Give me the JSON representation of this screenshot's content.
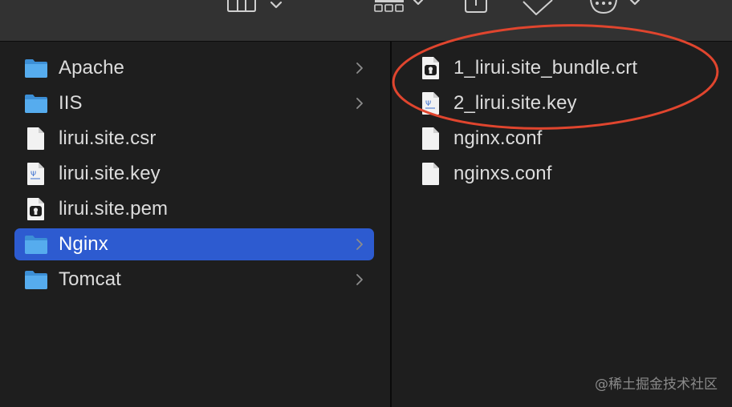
{
  "colors": {
    "toolbar_bg": "#323232",
    "window_bg": "#1e1e1e",
    "selection": "#2d5bd0",
    "folder_blue": "#4aa3e8",
    "text": "#dcdcdc",
    "annotation_red": "#e0452e"
  },
  "toolbar": {
    "icons": [
      "column-view-icon",
      "view-options-chevron-icon",
      "group-icon",
      "share-icon",
      "tag-icon",
      "more-icon"
    ]
  },
  "left_column": {
    "items": [
      {
        "label": "Apache",
        "type": "folder",
        "has_children": true,
        "selected": false
      },
      {
        "label": "IIS",
        "type": "folder",
        "has_children": true,
        "selected": false
      },
      {
        "label": "lirui.site.csr",
        "type": "blank-file",
        "has_children": false,
        "selected": false
      },
      {
        "label": "lirui.site.key",
        "type": "key-file",
        "has_children": false,
        "selected": false
      },
      {
        "label": "lirui.site.pem",
        "type": "cert-file",
        "has_children": false,
        "selected": false
      },
      {
        "label": "Nginx",
        "type": "folder",
        "has_children": true,
        "selected": true
      },
      {
        "label": "Tomcat",
        "type": "folder",
        "has_children": true,
        "selected": false
      }
    ]
  },
  "right_column": {
    "items": [
      {
        "label": "1_lirui.site_bundle.crt",
        "type": "cert-file"
      },
      {
        "label": "2_lirui.site.key",
        "type": "key-file"
      },
      {
        "label": "nginx.conf",
        "type": "blank-file"
      },
      {
        "label": "nginxs.conf",
        "type": "blank-file"
      }
    ]
  },
  "watermark": "@稀土掘金技术社区"
}
